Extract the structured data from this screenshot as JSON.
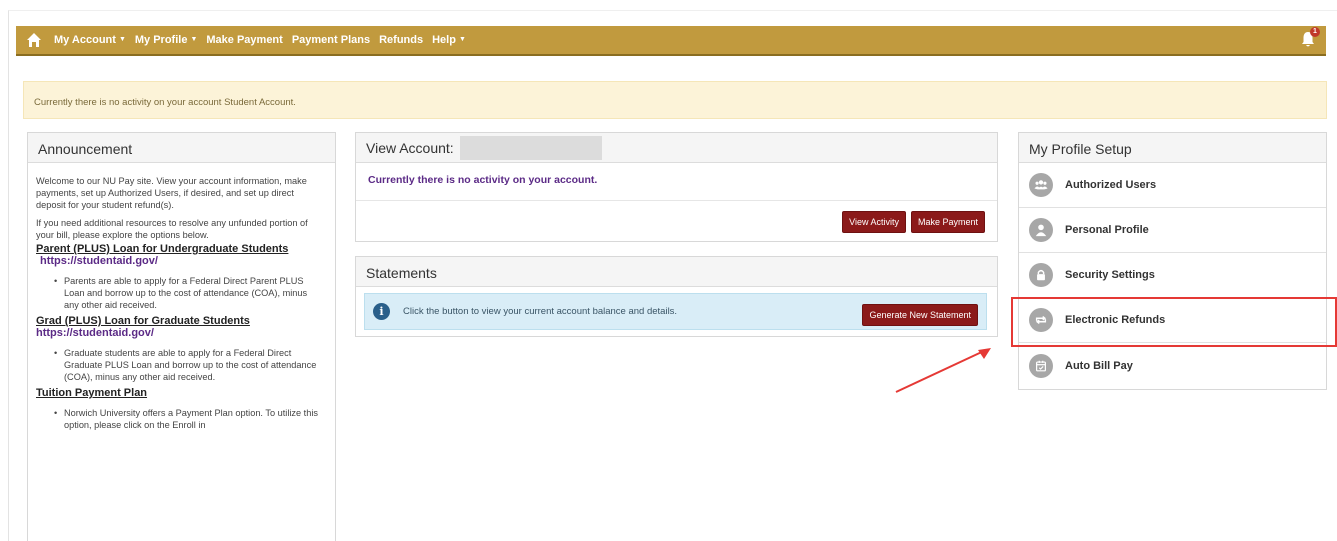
{
  "navbar": {
    "items": [
      {
        "label": "My Account",
        "caret": true
      },
      {
        "label": "My Profile",
        "caret": true
      },
      {
        "label": "Make Payment",
        "caret": false
      },
      {
        "label": "Payment Plans",
        "caret": false
      },
      {
        "label": "Refunds",
        "caret": false
      },
      {
        "label": "Help",
        "caret": true
      }
    ],
    "notification_count": "1"
  },
  "alert": {
    "text": "Currently there is no activity on your account Student Account."
  },
  "announcement": {
    "title": "Announcement",
    "intro": "Welcome to our NU Pay site. View your account information, make payments, set up Authorized Users, if desired, and set up direct deposit for your student refund(s).",
    "resources": "If you need additional resources to resolve any unfunded portion of your bill, please explore the options below.",
    "sections": [
      {
        "heading": "Parent (PLUS) Loan for Undergraduate Students",
        "link": "https://studentaid.gov/",
        "bullet": "Parents are able to apply for a Federal Direct Parent PLUS Loan and borrow up to the cost of attendance (COA), minus any other aid received."
      },
      {
        "heading": "Grad (PLUS) Loan for Graduate Students",
        "link": "https://studentaid.gov/",
        "bullet": "Graduate students are able to apply for a Federal Direct Graduate PLUS Loan and borrow up to the cost of attendance (COA), minus any other aid received."
      },
      {
        "heading": "Tuition Payment Plan",
        "link": "",
        "bullet": "Norwich University offers a Payment Plan option. To utilize this option, please click on the Enroll in"
      }
    ]
  },
  "view_account": {
    "title": "View Account:",
    "message": "Currently there is no activity on your account.",
    "view_activity_label": "View Activity",
    "make_payment_label": "Make Payment"
  },
  "statements": {
    "title": "Statements",
    "info_text": "Click the button to view your current account balance and details.",
    "generate_label": "Generate New Statement"
  },
  "profile_setup": {
    "title": "My Profile Setup",
    "items": [
      {
        "label": "Authorized Users",
        "icon": "users-icon"
      },
      {
        "label": "Personal Profile",
        "icon": "user-icon"
      },
      {
        "label": "Security Settings",
        "icon": "lock-icon"
      },
      {
        "label": "Electronic Refunds",
        "icon": "refresh-icon"
      },
      {
        "label": "Auto Bill Pay",
        "icon": "calendar-icon"
      }
    ]
  },
  "colors": {
    "navbar": "#c19a3e",
    "button": "#8b1a1a",
    "highlight": "#e53935",
    "link": "#5b2a86"
  }
}
